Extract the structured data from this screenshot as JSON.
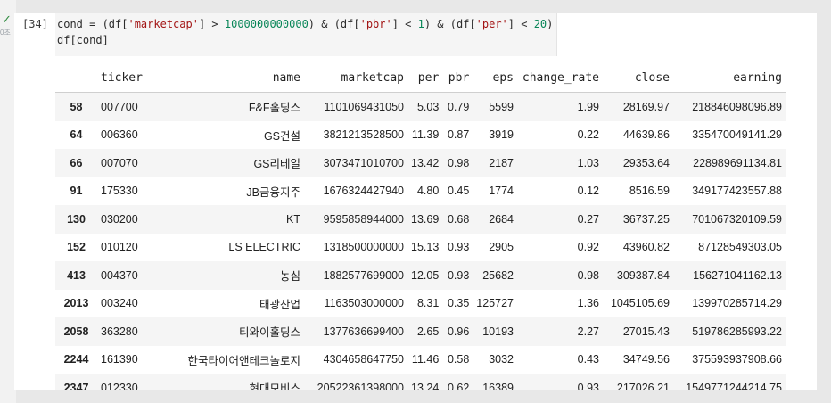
{
  "cell": {
    "status": "✓",
    "exec_time": "0초",
    "exec_count": "[34]",
    "code_line_1": [
      {
        "t": "cond = (df[",
        "k": "plain"
      },
      {
        "t": "'marketcap'",
        "k": "str"
      },
      {
        "t": "] > ",
        "k": "plain"
      },
      {
        "t": "1000000000000",
        "k": "num"
      },
      {
        "t": ") & (df[",
        "k": "plain"
      },
      {
        "t": "'pbr'",
        "k": "str"
      },
      {
        "t": "] < ",
        "k": "plain"
      },
      {
        "t": "1",
        "k": "num"
      },
      {
        "t": ") & (df[",
        "k": "plain"
      },
      {
        "t": "'per'",
        "k": "str"
      },
      {
        "t": "] < ",
        "k": "plain"
      },
      {
        "t": "20",
        "k": "num"
      },
      {
        "t": ")",
        "k": "plain"
      }
    ],
    "code_line_2": "df[cond]"
  },
  "table": {
    "columns": [
      "",
      "ticker",
      "name",
      "marketcap",
      "per",
      "pbr",
      "eps",
      "change_rate",
      "close",
      "earning"
    ],
    "rows": [
      [
        "58",
        "007700",
        "F&F홀딩스",
        "1101069431050",
        "5.03",
        "0.79",
        "5599",
        "1.99",
        "28169.97",
        "218846098096.89"
      ],
      [
        "64",
        "006360",
        "GS건설",
        "3821213528500",
        "11.39",
        "0.87",
        "3919",
        "0.22",
        "44639.86",
        "335470049141.29"
      ],
      [
        "66",
        "007070",
        "GS리테일",
        "3073471010700",
        "13.42",
        "0.98",
        "2187",
        "1.03",
        "29353.64",
        "228989691134.81"
      ],
      [
        "91",
        "175330",
        "JB금융지주",
        "1676324427940",
        "4.80",
        "0.45",
        "1774",
        "0.12",
        "8516.59",
        "349177423557.88"
      ],
      [
        "130",
        "030200",
        "KT",
        "9595858944000",
        "13.69",
        "0.68",
        "2684",
        "0.27",
        "36737.25",
        "701067320109.59"
      ],
      [
        "152",
        "010120",
        "LS ELECTRIC",
        "1318500000000",
        "15.13",
        "0.93",
        "2905",
        "0.92",
        "43960.82",
        "87128549303.05"
      ],
      [
        "413",
        "004370",
        "농심",
        "1882577699000",
        "12.05",
        "0.93",
        "25682",
        "0.98",
        "309387.84",
        "156271041162.13"
      ],
      [
        "2013",
        "003240",
        "태광산업",
        "1163503000000",
        "8.31",
        "0.35",
        "125727",
        "1.36",
        "1045105.69",
        "139970285714.29"
      ],
      [
        "2058",
        "363280",
        "티와이홀딩스",
        "1377636699400",
        "2.65",
        "0.96",
        "10193",
        "2.27",
        "27015.43",
        "519786285993.22"
      ],
      [
        "2244",
        "161390",
        "한국타이어앤테크놀로지",
        "4304658647750",
        "11.46",
        "0.58",
        "3032",
        "0.43",
        "34749.56",
        "375593937908.66"
      ],
      [
        "2347",
        "012330",
        "현대모비스",
        "20522361398000",
        "13.24",
        "0.62",
        "16389",
        "0.93",
        "217026.21",
        "1549771244214.75"
      ]
    ]
  },
  "colors": {
    "success": "#2e8b3e",
    "string_token": "#a31515",
    "number_token": "#098658",
    "stripe": "#f5f5f5"
  }
}
